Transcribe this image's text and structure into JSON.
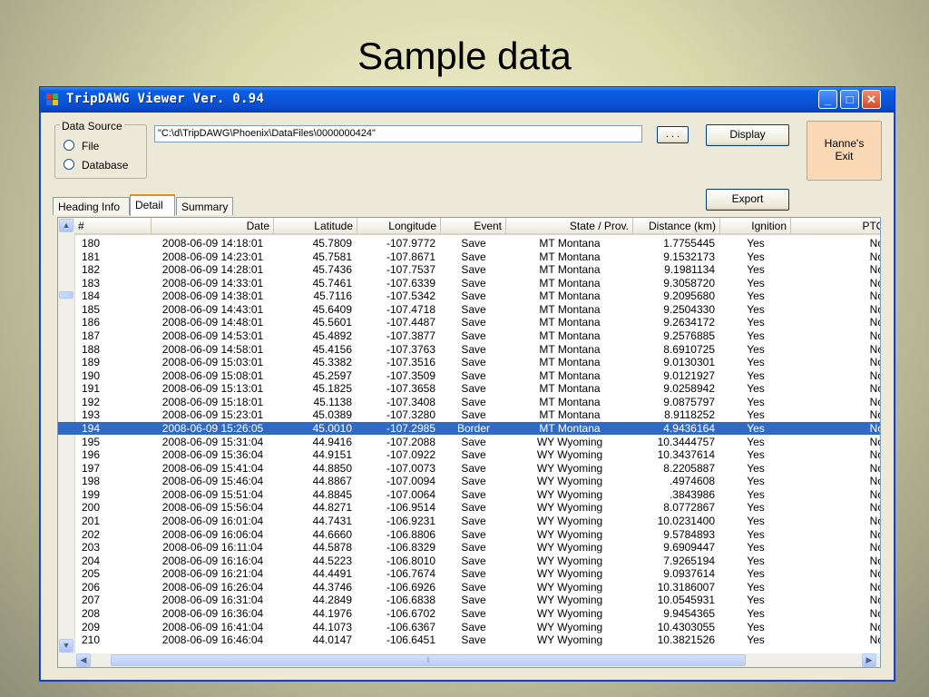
{
  "slide": {
    "title": "Sample data"
  },
  "window": {
    "title": "TripDAWG Viewer  Ver. 0.94",
    "controls": {
      "minimize": "_",
      "maximize": "□",
      "close": "✕"
    }
  },
  "data_source": {
    "label": "Data Source",
    "options": [
      "File",
      "Database"
    ]
  },
  "path_field": {
    "value": "\"C:\\d\\TripDAWG\\Phoenix\\DataFiles\\0000000424\""
  },
  "buttons": {
    "browse": ". . .",
    "display": "Display",
    "export": "Export",
    "exit_line1": "Hanne's",
    "exit_line2": "Exit"
  },
  "tabs": [
    "Heading Info",
    "Detail",
    "Summary"
  ],
  "table": {
    "columns": [
      "#",
      "Date",
      "Latitude",
      "Longitude",
      "Event",
      "State / Prov.",
      "Distance (km)",
      "Ignition",
      "PTO"
    ],
    "selected_row": 14,
    "rows": [
      [
        "180",
        "2008-06-09 14:18:01",
        "45.7809",
        "-107.9772",
        "Save",
        "MT Montana",
        "1.7755445",
        "Yes",
        "No"
      ],
      [
        "181",
        "2008-06-09 14:23:01",
        "45.7581",
        "-107.8671",
        "Save",
        "MT Montana",
        "9.1532173",
        "Yes",
        "No"
      ],
      [
        "182",
        "2008-06-09 14:28:01",
        "45.7436",
        "-107.7537",
        "Save",
        "MT Montana",
        "9.1981134",
        "Yes",
        "No"
      ],
      [
        "183",
        "2008-06-09 14:33:01",
        "45.7461",
        "-107.6339",
        "Save",
        "MT Montana",
        "9.3058720",
        "Yes",
        "No"
      ],
      [
        "184",
        "2008-06-09 14:38:01",
        "45.7116",
        "-107.5342",
        "Save",
        "MT Montana",
        "9.2095680",
        "Yes",
        "No"
      ],
      [
        "185",
        "2008-06-09 14:43:01",
        "45.6409",
        "-107.4718",
        "Save",
        "MT Montana",
        "9.2504330",
        "Yes",
        "No"
      ],
      [
        "186",
        "2008-06-09 14:48:01",
        "45.5601",
        "-107.4487",
        "Save",
        "MT Montana",
        "9.2634172",
        "Yes",
        "No"
      ],
      [
        "187",
        "2008-06-09 14:53:01",
        "45.4892",
        "-107.3877",
        "Save",
        "MT Montana",
        "9.2576885",
        "Yes",
        "No"
      ],
      [
        "188",
        "2008-06-09 14:58:01",
        "45.4156",
        "-107.3763",
        "Save",
        "MT Montana",
        "8.6910725",
        "Yes",
        "No"
      ],
      [
        "189",
        "2008-06-09 15:03:01",
        "45.3382",
        "-107.3516",
        "Save",
        "MT Montana",
        "9.0130301",
        "Yes",
        "No"
      ],
      [
        "190",
        "2008-06-09 15:08:01",
        "45.2597",
        "-107.3509",
        "Save",
        "MT Montana",
        "9.0121927",
        "Yes",
        "No"
      ],
      [
        "191",
        "2008-06-09 15:13:01",
        "45.1825",
        "-107.3658",
        "Save",
        "MT Montana",
        "9.0258942",
        "Yes",
        "No"
      ],
      [
        "192",
        "2008-06-09 15:18:01",
        "45.1138",
        "-107.3408",
        "Save",
        "MT Montana",
        "9.0875797",
        "Yes",
        "No"
      ],
      [
        "193",
        "2008-06-09 15:23:01",
        "45.0389",
        "-107.3280",
        "Save",
        "MT Montana",
        "8.9118252",
        "Yes",
        "No"
      ],
      [
        "194",
        "2008-06-09 15:26:05",
        "45.0010",
        "-107.2985",
        "Border",
        "MT Montana",
        "4.9436164",
        "Yes",
        "No"
      ],
      [
        "195",
        "2008-06-09 15:31:04",
        "44.9416",
        "-107.2088",
        "Save",
        "WY Wyoming",
        "10.3444757",
        "Yes",
        "No"
      ],
      [
        "196",
        "2008-06-09 15:36:04",
        "44.9151",
        "-107.0922",
        "Save",
        "WY Wyoming",
        "10.3437614",
        "Yes",
        "No"
      ],
      [
        "197",
        "2008-06-09 15:41:04",
        "44.8850",
        "-107.0073",
        "Save",
        "WY Wyoming",
        "8.2205887",
        "Yes",
        "No"
      ],
      [
        "198",
        "2008-06-09 15:46:04",
        "44.8867",
        "-107.0094",
        "Save",
        "WY Wyoming",
        ".4974608",
        "Yes",
        "No"
      ],
      [
        "199",
        "2008-06-09 15:51:04",
        "44.8845",
        "-107.0064",
        "Save",
        "WY Wyoming",
        ".3843986",
        "Yes",
        "No"
      ],
      [
        "200",
        "2008-06-09 15:56:04",
        "44.8271",
        "-106.9514",
        "Save",
        "WY Wyoming",
        "8.0772867",
        "Yes",
        "No"
      ],
      [
        "201",
        "2008-06-09 16:01:04",
        "44.7431",
        "-106.9231",
        "Save",
        "WY Wyoming",
        "10.0231400",
        "Yes",
        "No"
      ],
      [
        "202",
        "2008-06-09 16:06:04",
        "44.6660",
        "-106.8806",
        "Save",
        "WY Wyoming",
        "9.5784893",
        "Yes",
        "No"
      ],
      [
        "203",
        "2008-06-09 16:11:04",
        "44.5878",
        "-106.8329",
        "Save",
        "WY Wyoming",
        "9.6909447",
        "Yes",
        "No"
      ],
      [
        "204",
        "2008-06-09 16:16:04",
        "44.5223",
        "-106.8010",
        "Save",
        "WY Wyoming",
        "7.9265194",
        "Yes",
        "No"
      ],
      [
        "205",
        "2008-06-09 16:21:04",
        "44.4491",
        "-106.7674",
        "Save",
        "WY Wyoming",
        "9.0937614",
        "Yes",
        "No"
      ],
      [
        "206",
        "2008-06-09 16:26:04",
        "44.3746",
        "-106.6926",
        "Save",
        "WY Wyoming",
        "10.3186007",
        "Yes",
        "No"
      ],
      [
        "207",
        "2008-06-09 16:31:04",
        "44.2849",
        "-106.6838",
        "Save",
        "WY Wyoming",
        "10.0545931",
        "Yes",
        "No"
      ],
      [
        "208",
        "2008-06-09 16:36:04",
        "44.1976",
        "-106.6702",
        "Save",
        "WY Wyoming",
        "9.9454365",
        "Yes",
        "No"
      ],
      [
        "209",
        "2008-06-09 16:41:04",
        "44.1073",
        "-106.6367",
        "Save",
        "WY Wyoming",
        "10.4303055",
        "Yes",
        "No"
      ],
      [
        "210",
        "2008-06-09 16:46:04",
        "44.0147",
        "-106.6451",
        "Save",
        "WY Wyoming",
        "10.3821526",
        "Yes",
        "No"
      ]
    ]
  },
  "colors": {
    "selection": "#316ac5",
    "titlebar": "#0a53d6",
    "exit_button": "#fcd9b6"
  },
  "icons": {
    "scroll_up": "chevron-up-icon",
    "scroll_down": "chevron-down-icon",
    "scroll_left": "chevron-left-icon",
    "scroll_right": "chevron-right-icon"
  }
}
